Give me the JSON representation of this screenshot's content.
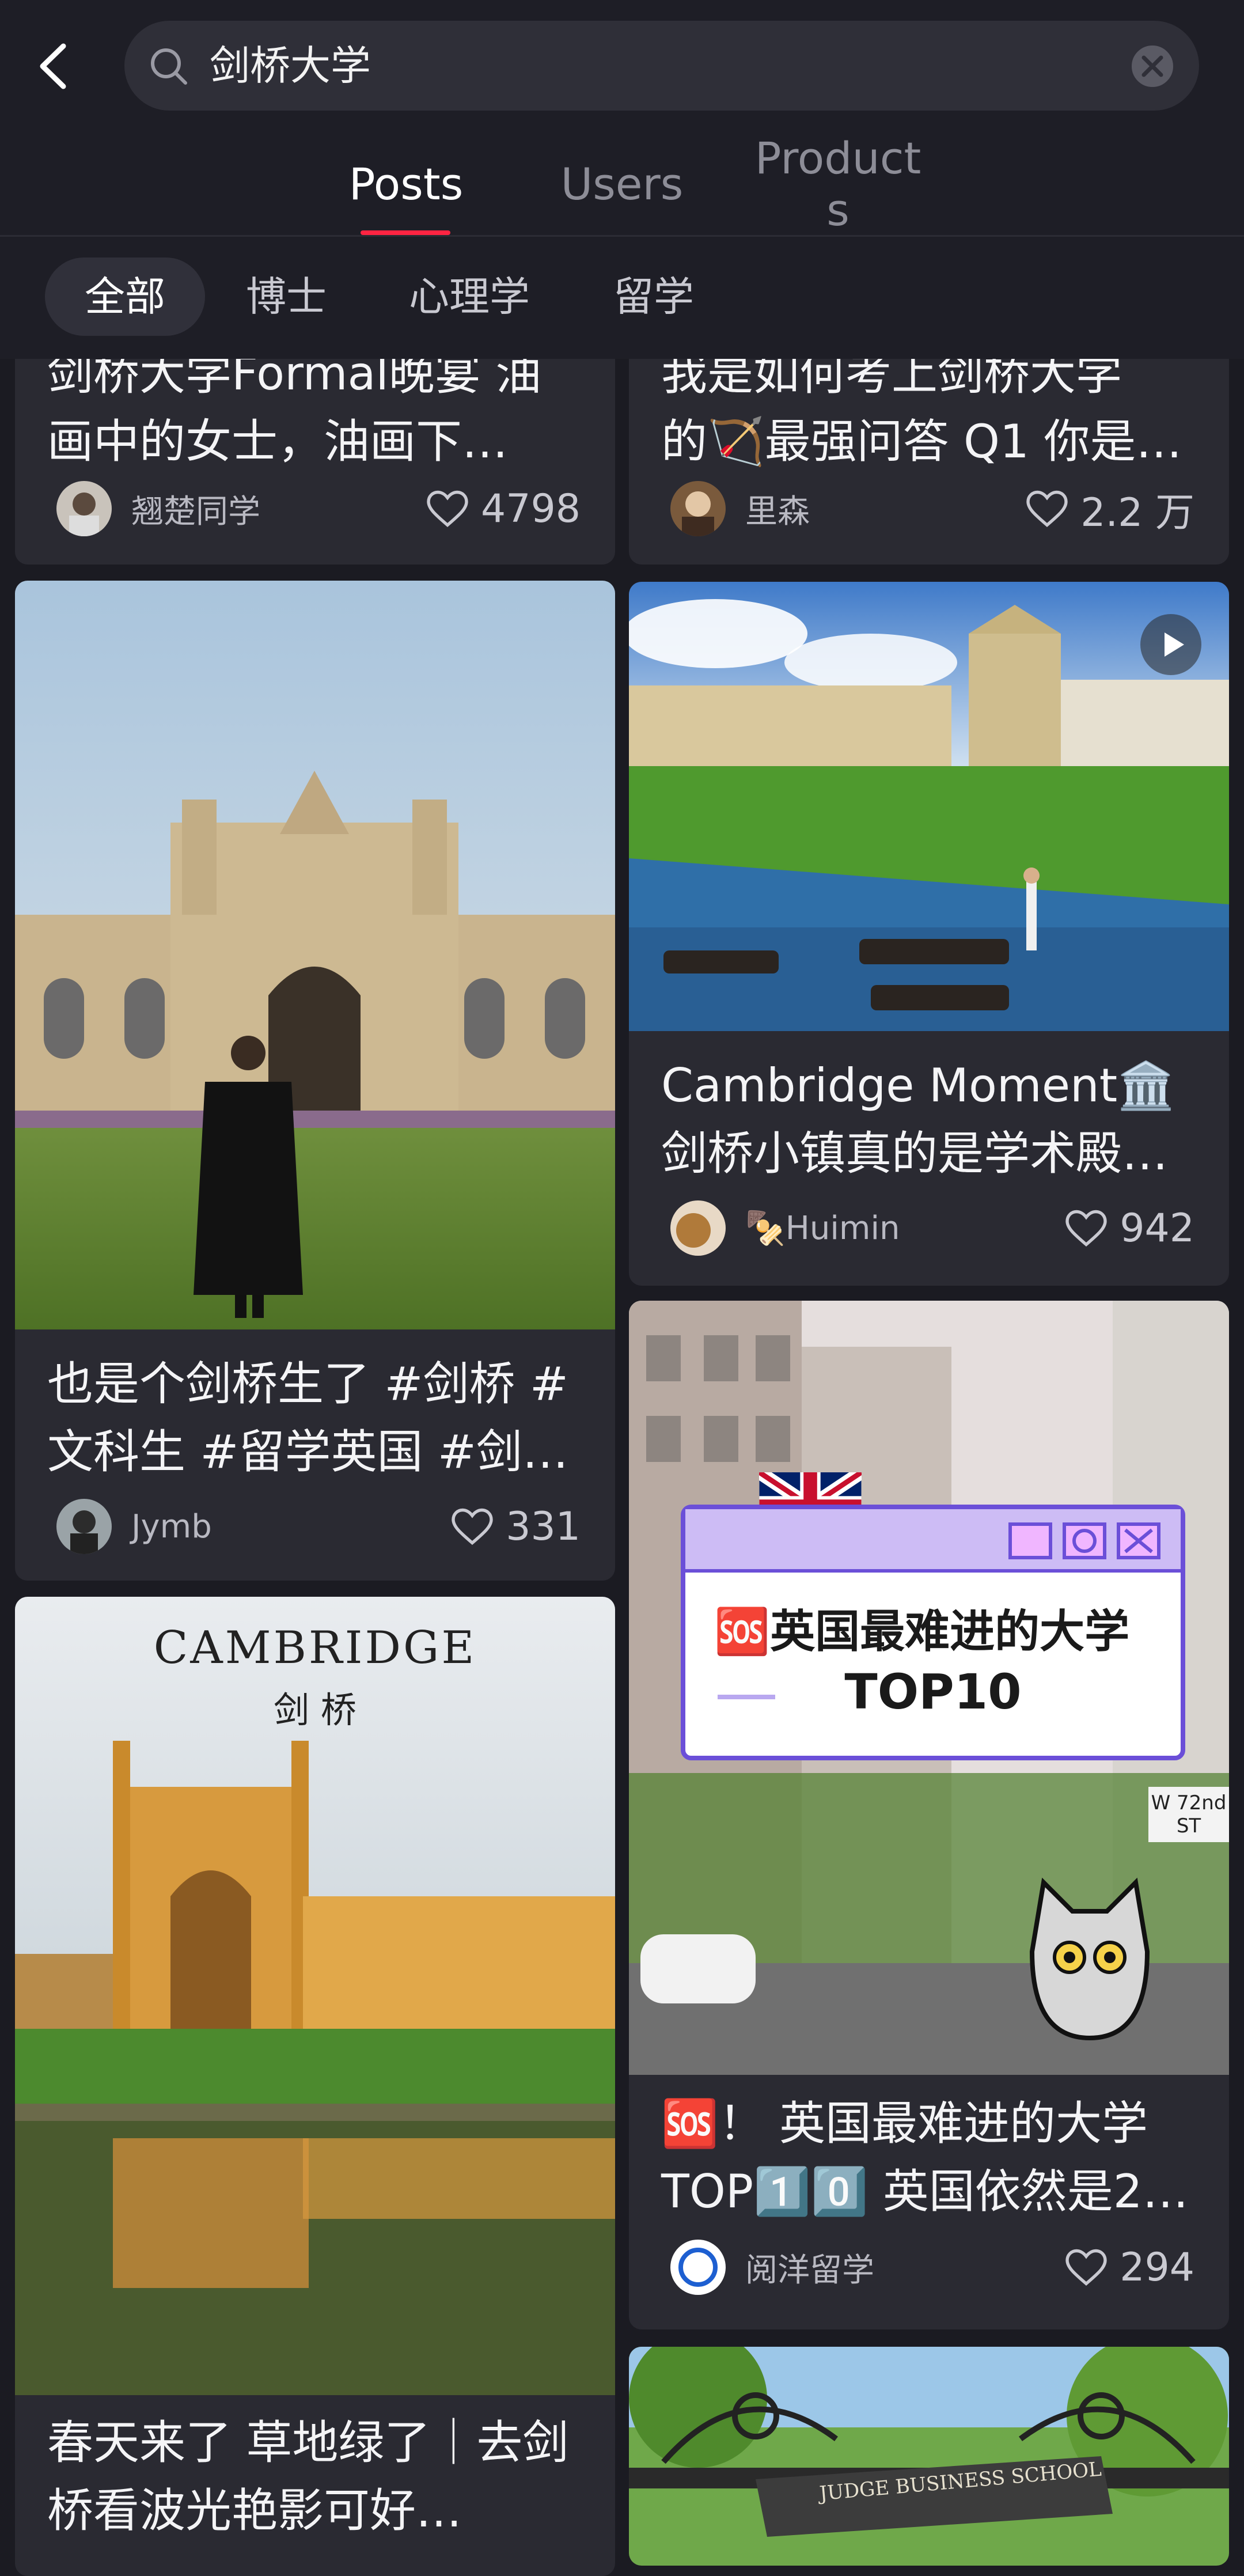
{
  "search": {
    "query": "剑桥大学"
  },
  "tabs": [
    {
      "label": "Posts"
    },
    {
      "label": "Users"
    },
    {
      "label": "Products"
    }
  ],
  "chips": [
    {
      "label": "全部"
    },
    {
      "label": "博士"
    },
    {
      "label": "心理学"
    },
    {
      "label": "留学"
    }
  ],
  "posts": [
    {
      "title_top": "剑桥大学Formal晚宴 油",
      "title": "画中的女士，油画下…",
      "author": "翘楚同学",
      "likes": "4798"
    },
    {
      "title_top": "我是如何考上剑桥大学",
      "title": "的🏹最强问答 Q1 你是…",
      "author": "里森",
      "likes": "2.2 万"
    },
    {
      "title": "也是个剑桥生了 #剑桥 #文科生 #留学英国 #剑…",
      "author": "Jymb",
      "likes": "331"
    },
    {
      "title": "Cambridge Moment🏛️ 剑桥小镇真的是学术殿…",
      "author": "🍢Huimin",
      "likes": "942",
      "has_video": true
    },
    {
      "title": "🆘！ 英国最难进的大学TOP1️⃣0️⃣ 英国依然是2…",
      "author": "阅洋留学",
      "likes": "294",
      "image_caption": {
        "line1": "🆘英国最难进的大学",
        "line2": "TOP10",
        "street": "W 72nd ST"
      }
    },
    {
      "title": "春天来了 草地绿了｜去剑桥看波光艳影可好…",
      "image_caption": {
        "en": "CAMBRIDGE",
        "zh": "剑 桥"
      }
    },
    {
      "image_caption": {
        "sign": "JUDGE BUSINESS SCHOOL"
      }
    }
  ],
  "colors": {
    "accent": "#ff2442",
    "background": "#1b1b22",
    "card": "#2a2a32"
  }
}
